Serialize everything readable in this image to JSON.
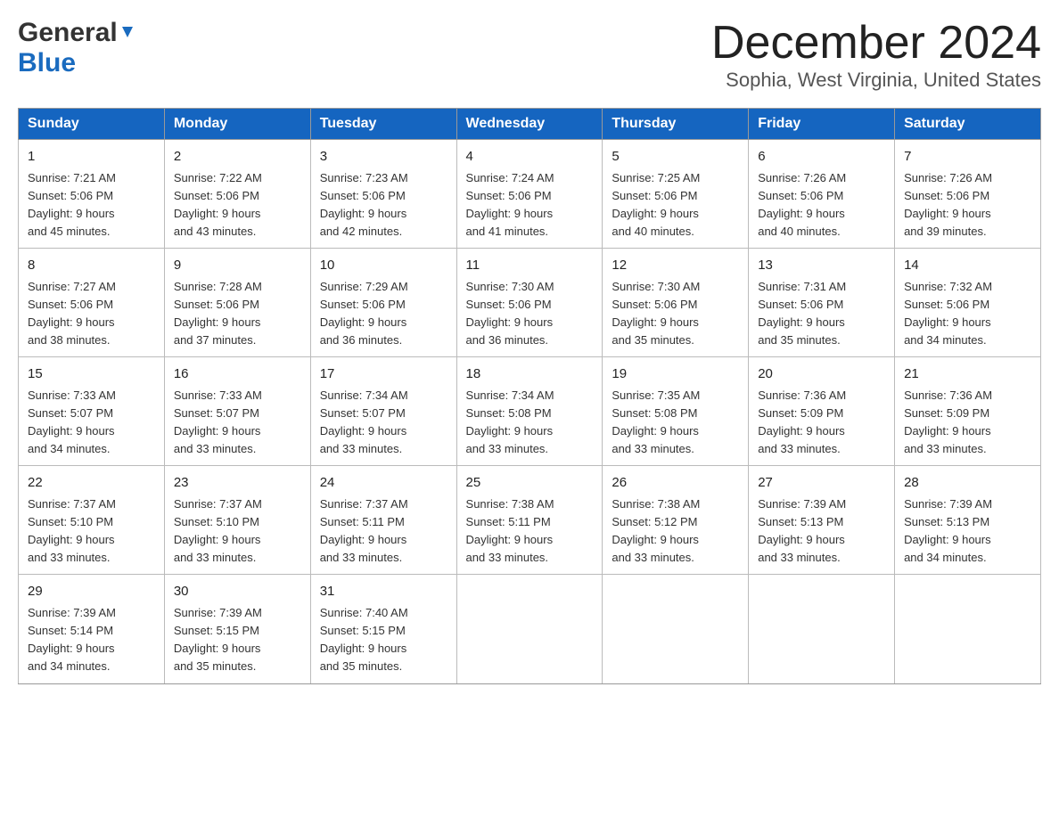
{
  "header": {
    "logo_line1": "General",
    "logo_line2": "Blue",
    "month_title": "December 2024",
    "location": "Sophia, West Virginia, United States"
  },
  "days_of_week": [
    "Sunday",
    "Monday",
    "Tuesday",
    "Wednesday",
    "Thursday",
    "Friday",
    "Saturday"
  ],
  "weeks": [
    [
      {
        "day": "1",
        "sunrise": "7:21 AM",
        "sunset": "5:06 PM",
        "daylight": "9 hours and 45 minutes."
      },
      {
        "day": "2",
        "sunrise": "7:22 AM",
        "sunset": "5:06 PM",
        "daylight": "9 hours and 43 minutes."
      },
      {
        "day": "3",
        "sunrise": "7:23 AM",
        "sunset": "5:06 PM",
        "daylight": "9 hours and 42 minutes."
      },
      {
        "day": "4",
        "sunrise": "7:24 AM",
        "sunset": "5:06 PM",
        "daylight": "9 hours and 41 minutes."
      },
      {
        "day": "5",
        "sunrise": "7:25 AM",
        "sunset": "5:06 PM",
        "daylight": "9 hours and 40 minutes."
      },
      {
        "day": "6",
        "sunrise": "7:26 AM",
        "sunset": "5:06 PM",
        "daylight": "9 hours and 40 minutes."
      },
      {
        "day": "7",
        "sunrise": "7:26 AM",
        "sunset": "5:06 PM",
        "daylight": "9 hours and 39 minutes."
      }
    ],
    [
      {
        "day": "8",
        "sunrise": "7:27 AM",
        "sunset": "5:06 PM",
        "daylight": "9 hours and 38 minutes."
      },
      {
        "day": "9",
        "sunrise": "7:28 AM",
        "sunset": "5:06 PM",
        "daylight": "9 hours and 37 minutes."
      },
      {
        "day": "10",
        "sunrise": "7:29 AM",
        "sunset": "5:06 PM",
        "daylight": "9 hours and 36 minutes."
      },
      {
        "day": "11",
        "sunrise": "7:30 AM",
        "sunset": "5:06 PM",
        "daylight": "9 hours and 36 minutes."
      },
      {
        "day": "12",
        "sunrise": "7:30 AM",
        "sunset": "5:06 PM",
        "daylight": "9 hours and 35 minutes."
      },
      {
        "day": "13",
        "sunrise": "7:31 AM",
        "sunset": "5:06 PM",
        "daylight": "9 hours and 35 minutes."
      },
      {
        "day": "14",
        "sunrise": "7:32 AM",
        "sunset": "5:06 PM",
        "daylight": "9 hours and 34 minutes."
      }
    ],
    [
      {
        "day": "15",
        "sunrise": "7:33 AM",
        "sunset": "5:07 PM",
        "daylight": "9 hours and 34 minutes."
      },
      {
        "day": "16",
        "sunrise": "7:33 AM",
        "sunset": "5:07 PM",
        "daylight": "9 hours and 33 minutes."
      },
      {
        "day": "17",
        "sunrise": "7:34 AM",
        "sunset": "5:07 PM",
        "daylight": "9 hours and 33 minutes."
      },
      {
        "day": "18",
        "sunrise": "7:34 AM",
        "sunset": "5:08 PM",
        "daylight": "9 hours and 33 minutes."
      },
      {
        "day": "19",
        "sunrise": "7:35 AM",
        "sunset": "5:08 PM",
        "daylight": "9 hours and 33 minutes."
      },
      {
        "day": "20",
        "sunrise": "7:36 AM",
        "sunset": "5:09 PM",
        "daylight": "9 hours and 33 minutes."
      },
      {
        "day": "21",
        "sunrise": "7:36 AM",
        "sunset": "5:09 PM",
        "daylight": "9 hours and 33 minutes."
      }
    ],
    [
      {
        "day": "22",
        "sunrise": "7:37 AM",
        "sunset": "5:10 PM",
        "daylight": "9 hours and 33 minutes."
      },
      {
        "day": "23",
        "sunrise": "7:37 AM",
        "sunset": "5:10 PM",
        "daylight": "9 hours and 33 minutes."
      },
      {
        "day": "24",
        "sunrise": "7:37 AM",
        "sunset": "5:11 PM",
        "daylight": "9 hours and 33 minutes."
      },
      {
        "day": "25",
        "sunrise": "7:38 AM",
        "sunset": "5:11 PM",
        "daylight": "9 hours and 33 minutes."
      },
      {
        "day": "26",
        "sunrise": "7:38 AM",
        "sunset": "5:12 PM",
        "daylight": "9 hours and 33 minutes."
      },
      {
        "day": "27",
        "sunrise": "7:39 AM",
        "sunset": "5:13 PM",
        "daylight": "9 hours and 33 minutes."
      },
      {
        "day": "28",
        "sunrise": "7:39 AM",
        "sunset": "5:13 PM",
        "daylight": "9 hours and 34 minutes."
      }
    ],
    [
      {
        "day": "29",
        "sunrise": "7:39 AM",
        "sunset": "5:14 PM",
        "daylight": "9 hours and 34 minutes."
      },
      {
        "day": "30",
        "sunrise": "7:39 AM",
        "sunset": "5:15 PM",
        "daylight": "9 hours and 35 minutes."
      },
      {
        "day": "31",
        "sunrise": "7:40 AM",
        "sunset": "5:15 PM",
        "daylight": "9 hours and 35 minutes."
      },
      null,
      null,
      null,
      null
    ]
  ],
  "labels": {
    "sunrise": "Sunrise:",
    "sunset": "Sunset:",
    "daylight": "Daylight:"
  }
}
